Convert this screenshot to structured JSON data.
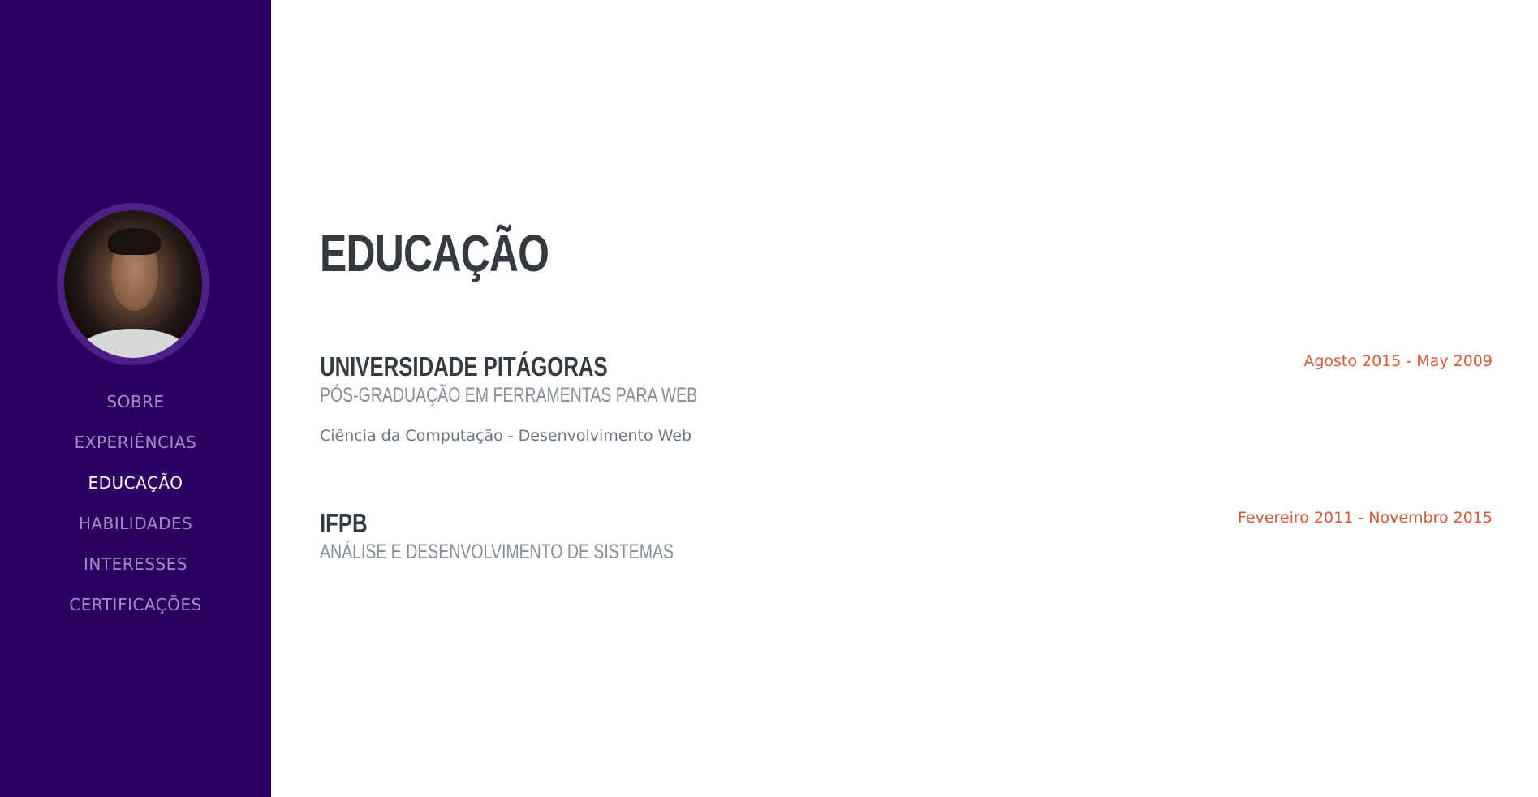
{
  "nav": {
    "items": [
      {
        "label": "SOBRE",
        "active": false
      },
      {
        "label": "EXPERIÊNCIAS",
        "active": false
      },
      {
        "label": "EDUCAÇÃO",
        "active": true
      },
      {
        "label": "HABILIDADES",
        "active": false
      },
      {
        "label": "INTERESSES",
        "active": false
      },
      {
        "label": "CERTIFICAÇÕES",
        "active": false
      }
    ]
  },
  "section": {
    "title": "EDUCAÇÃO"
  },
  "education": [
    {
      "institution": "UNIVERSIDADE PITÁGORAS",
      "degree": "PÓS-GRADUAÇÃO EM FERRAMENTAS PARA WEB",
      "description": "Ciência da Computação - Desenvolvimento Web",
      "date": "Agosto 2015 - May 2009"
    },
    {
      "institution": "IFPB",
      "degree": "ANÁLISE E DESENVOLVIMENTO DE SISTEMAS",
      "date": "Fevereiro 2011 - Novembro 2015"
    }
  ],
  "colors": {
    "sidebar_bg": "#2b0060",
    "nav_text": "#a48bc8",
    "nav_active": "#ffffff",
    "heading": "#343a40",
    "subheading": "#868e96",
    "date_accent": "#d35a37"
  }
}
